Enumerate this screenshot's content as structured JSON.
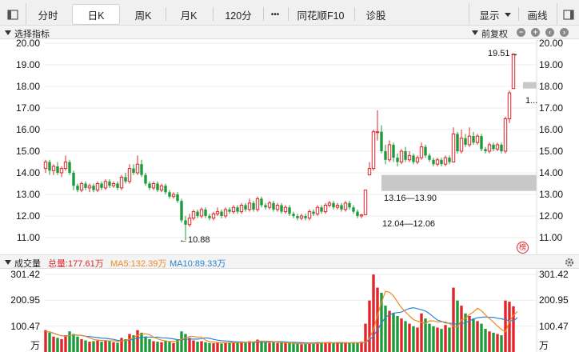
{
  "toolbar": {
    "tabs": [
      "分时",
      "日K",
      "周K",
      "月K",
      "120分",
      "•••",
      "同花顺F10",
      "诊股"
    ],
    "active": "日K",
    "display_label": "显示",
    "draw_label": "画线"
  },
  "indicator_header": {
    "label": "选择指标",
    "adjust_label": "前复权"
  },
  "price_axis": {
    "ticks": [
      "20.00",
      "19.00",
      "18.00",
      "17.00",
      "16.00",
      "15.00",
      "14.00",
      "13.00",
      "12.00",
      "11.00"
    ]
  },
  "annotations": {
    "high": "19.51→",
    "low": "←10.88",
    "gap_upper": "13.16—13.90",
    "gap_lower": "12.04—12.06",
    "cut_label": "1..."
  },
  "badge": "榜",
  "volume_header": {
    "label": "成交量",
    "total": "总量:177.61万",
    "ma5": "MA5:132.39万",
    "ma10": "MA10:89.33万"
  },
  "volume_axis": {
    "ticks": [
      "301.42",
      "200.95",
      "100.47"
    ],
    "unit": "万"
  },
  "colors": {
    "up": "#e0252b",
    "down": "#1c9b3a",
    "ma5": "#f08a1e",
    "ma10": "#2a84d6",
    "gap": "#c8c8c8"
  },
  "chart_data": {
    "type": "candlestick",
    "price_ylim": [
      10.5,
      20.5
    ],
    "volume_ylim": [
      0,
      301.42
    ],
    "candles": [
      {
        "o": 14.2,
        "c": 14.5,
        "h": 14.6,
        "l": 14.0,
        "v": 85
      },
      {
        "o": 14.5,
        "c": 14.1,
        "h": 14.6,
        "l": 13.9,
        "v": 75
      },
      {
        "o": 14.1,
        "c": 14.3,
        "h": 14.4,
        "l": 13.9,
        "v": 60
      },
      {
        "o": 14.3,
        "c": 14.0,
        "h": 14.5,
        "l": 13.9,
        "v": 55
      },
      {
        "o": 14.0,
        "c": 14.2,
        "h": 14.3,
        "l": 13.8,
        "v": 50
      },
      {
        "o": 14.2,
        "c": 14.5,
        "h": 14.8,
        "l": 14.1,
        "v": 65
      },
      {
        "o": 14.5,
        "c": 14.0,
        "h": 14.6,
        "l": 13.9,
        "v": 80
      },
      {
        "o": 14.0,
        "c": 13.4,
        "h": 14.1,
        "l": 13.2,
        "v": 70
      },
      {
        "o": 13.4,
        "c": 13.2,
        "h": 13.5,
        "l": 13.1,
        "v": 60
      },
      {
        "o": 13.2,
        "c": 13.5,
        "h": 13.6,
        "l": 13.1,
        "v": 50
      },
      {
        "o": 13.5,
        "c": 13.3,
        "h": 13.6,
        "l": 13.2,
        "v": 45
      },
      {
        "o": 13.3,
        "c": 13.4,
        "h": 13.5,
        "l": 13.1,
        "v": 40
      },
      {
        "o": 13.4,
        "c": 13.2,
        "h": 13.5,
        "l": 13.1,
        "v": 42
      },
      {
        "o": 13.2,
        "c": 13.5,
        "h": 13.6,
        "l": 13.1,
        "v": 48
      },
      {
        "o": 13.5,
        "c": 13.3,
        "h": 13.6,
        "l": 13.2,
        "v": 40
      },
      {
        "o": 13.3,
        "c": 13.6,
        "h": 13.7,
        "l": 13.2,
        "v": 46
      },
      {
        "o": 13.6,
        "c": 13.4,
        "h": 13.7,
        "l": 13.3,
        "v": 44
      },
      {
        "o": 13.4,
        "c": 13.5,
        "h": 13.6,
        "l": 13.3,
        "v": 38
      },
      {
        "o": 13.5,
        "c": 13.3,
        "h": 13.6,
        "l": 13.2,
        "v": 36
      },
      {
        "o": 13.3,
        "c": 13.8,
        "h": 13.9,
        "l": 13.2,
        "v": 55
      },
      {
        "o": 13.8,
        "c": 13.6,
        "h": 14.0,
        "l": 13.5,
        "v": 50
      },
      {
        "o": 13.6,
        "c": 14.2,
        "h": 14.4,
        "l": 13.5,
        "v": 70
      },
      {
        "o": 14.2,
        "c": 14.0,
        "h": 14.4,
        "l": 13.9,
        "v": 65
      },
      {
        "o": 14.0,
        "c": 14.4,
        "h": 14.8,
        "l": 13.9,
        "v": 85
      },
      {
        "o": 14.4,
        "c": 13.9,
        "h": 14.6,
        "l": 13.8,
        "v": 75
      },
      {
        "o": 13.9,
        "c": 13.5,
        "h": 14.0,
        "l": 13.4,
        "v": 60
      },
      {
        "o": 13.5,
        "c": 13.3,
        "h": 13.6,
        "l": 13.2,
        "v": 50
      },
      {
        "o": 13.3,
        "c": 13.5,
        "h": 13.6,
        "l": 13.2,
        "v": 42
      },
      {
        "o": 13.5,
        "c": 13.2,
        "h": 13.6,
        "l": 13.1,
        "v": 40
      },
      {
        "o": 13.2,
        "c": 13.4,
        "h": 13.5,
        "l": 13.1,
        "v": 38
      },
      {
        "o": 13.4,
        "c": 13.1,
        "h": 13.5,
        "l": 13.0,
        "v": 45
      },
      {
        "o": 13.1,
        "c": 12.9,
        "h": 13.2,
        "l": 12.8,
        "v": 40
      },
      {
        "o": 12.9,
        "c": 13.0,
        "h": 13.1,
        "l": 12.8,
        "v": 35
      },
      {
        "o": 13.0,
        "c": 12.7,
        "h": 13.1,
        "l": 12.6,
        "v": 48
      },
      {
        "o": 12.7,
        "c": 11.8,
        "h": 12.8,
        "l": 11.7,
        "v": 80
      },
      {
        "o": 11.8,
        "c": 11.6,
        "h": 12.0,
        "l": 10.88,
        "v": 70
      },
      {
        "o": 11.6,
        "c": 11.9,
        "h": 12.1,
        "l": 11.5,
        "v": 55
      },
      {
        "o": 11.9,
        "c": 12.2,
        "h": 12.3,
        "l": 11.8,
        "v": 45
      },
      {
        "o": 12.2,
        "c": 12.0,
        "h": 12.3,
        "l": 11.9,
        "v": 40
      },
      {
        "o": 12.0,
        "c": 12.3,
        "h": 12.4,
        "l": 11.9,
        "v": 42
      },
      {
        "o": 12.3,
        "c": 12.0,
        "h": 12.4,
        "l": 11.9,
        "v": 38
      },
      {
        "o": 12.0,
        "c": 11.9,
        "h": 12.1,
        "l": 11.8,
        "v": 35
      },
      {
        "o": 11.9,
        "c": 12.1,
        "h": 12.2,
        "l": 11.8,
        "v": 34
      },
      {
        "o": 12.1,
        "c": 12.2,
        "h": 12.4,
        "l": 12.0,
        "v": 36
      },
      {
        "o": 12.2,
        "c": 12.0,
        "h": 12.3,
        "l": 11.9,
        "v": 33
      },
      {
        "o": 12.0,
        "c": 12.3,
        "h": 12.4,
        "l": 11.9,
        "v": 37
      },
      {
        "o": 12.3,
        "c": 12.2,
        "h": 12.4,
        "l": 12.1,
        "v": 35
      },
      {
        "o": 12.2,
        "c": 12.4,
        "h": 12.5,
        "l": 12.1,
        "v": 38
      },
      {
        "o": 12.4,
        "c": 12.2,
        "h": 12.5,
        "l": 12.1,
        "v": 36
      },
      {
        "o": 12.2,
        "c": 12.5,
        "h": 12.6,
        "l": 12.1,
        "v": 40
      },
      {
        "o": 12.5,
        "c": 12.3,
        "h": 12.6,
        "l": 12.2,
        "v": 38
      },
      {
        "o": 12.3,
        "c": 12.6,
        "h": 12.8,
        "l": 12.2,
        "v": 42
      },
      {
        "o": 12.6,
        "c": 12.3,
        "h": 12.7,
        "l": 12.2,
        "v": 40
      },
      {
        "o": 12.3,
        "c": 12.8,
        "h": 12.9,
        "l": 12.2,
        "v": 48
      },
      {
        "o": 12.8,
        "c": 12.5,
        "h": 12.9,
        "l": 12.4,
        "v": 44
      },
      {
        "o": 12.5,
        "c": 12.4,
        "h": 12.6,
        "l": 12.3,
        "v": 38
      },
      {
        "o": 12.4,
        "c": 12.6,
        "h": 12.7,
        "l": 12.3,
        "v": 36
      },
      {
        "o": 12.6,
        "c": 12.3,
        "h": 12.7,
        "l": 12.2,
        "v": 40
      },
      {
        "o": 12.3,
        "c": 12.5,
        "h": 12.6,
        "l": 12.2,
        "v": 35
      },
      {
        "o": 12.5,
        "c": 12.2,
        "h": 12.6,
        "l": 12.1,
        "v": 38
      },
      {
        "o": 12.2,
        "c": 12.4,
        "h": 12.5,
        "l": 12.1,
        "v": 34
      },
      {
        "o": 12.4,
        "c": 12.1,
        "h": 12.5,
        "l": 12.0,
        "v": 36
      },
      {
        "o": 12.1,
        "c": 12.0,
        "h": 12.2,
        "l": 11.9,
        "v": 33
      },
      {
        "o": 12.0,
        "c": 11.9,
        "h": 12.1,
        "l": 11.8,
        "v": 32
      },
      {
        "o": 11.9,
        "c": 12.0,
        "h": 12.1,
        "l": 11.8,
        "v": 30
      },
      {
        "o": 12.0,
        "c": 11.9,
        "h": 12.1,
        "l": 11.8,
        "v": 31
      },
      {
        "o": 11.9,
        "c": 12.2,
        "h": 12.3,
        "l": 11.8,
        "v": 36
      },
      {
        "o": 12.2,
        "c": 12.1,
        "h": 12.3,
        "l": 12.0,
        "v": 33
      },
      {
        "o": 12.1,
        "c": 12.4,
        "h": 12.5,
        "l": 12.0,
        "v": 38
      },
      {
        "o": 12.4,
        "c": 12.2,
        "h": 12.5,
        "l": 12.1,
        "v": 35
      },
      {
        "o": 12.2,
        "c": 12.5,
        "h": 12.6,
        "l": 12.1,
        "v": 37
      },
      {
        "o": 12.5,
        "c": 12.6,
        "h": 12.7,
        "l": 12.4,
        "v": 39
      },
      {
        "o": 12.6,
        "c": 12.4,
        "h": 12.7,
        "l": 12.3,
        "v": 36
      },
      {
        "o": 12.4,
        "c": 12.5,
        "h": 12.6,
        "l": 12.3,
        "v": 34
      },
      {
        "o": 12.5,
        "c": 12.3,
        "h": 12.6,
        "l": 12.2,
        "v": 35
      },
      {
        "o": 12.3,
        "c": 12.6,
        "h": 12.7,
        "l": 12.2,
        "v": 38
      },
      {
        "o": 12.6,
        "c": 12.4,
        "h": 12.7,
        "l": 12.3,
        "v": 36
      },
      {
        "o": 12.4,
        "c": 12.2,
        "h": 12.5,
        "l": 12.1,
        "v": 34
      },
      {
        "o": 12.2,
        "c": 12.0,
        "h": 12.3,
        "l": 11.9,
        "v": 35
      },
      {
        "o": 12.0,
        "c": 12.05,
        "h": 12.1,
        "l": 11.9,
        "v": 40
      },
      {
        "o": 12.06,
        "c": 13.2,
        "h": 13.2,
        "l": 12.06,
        "v": 110
      },
      {
        "o": 13.9,
        "c": 14.2,
        "h": 14.5,
        "l": 13.9,
        "v": 200
      },
      {
        "o": 14.2,
        "c": 15.9,
        "h": 16.0,
        "l": 14.1,
        "v": 301
      },
      {
        "o": 15.9,
        "c": 15.9,
        "h": 16.9,
        "l": 15.5,
        "v": 250
      },
      {
        "o": 15.9,
        "c": 15.0,
        "h": 16.2,
        "l": 14.9,
        "v": 230
      },
      {
        "o": 15.0,
        "c": 14.6,
        "h": 15.3,
        "l": 14.4,
        "v": 180
      },
      {
        "o": 14.6,
        "c": 15.3,
        "h": 15.5,
        "l": 14.5,
        "v": 160
      },
      {
        "o": 15.3,
        "c": 14.7,
        "h": 15.4,
        "l": 14.5,
        "v": 150
      },
      {
        "o": 14.7,
        "c": 14.5,
        "h": 14.9,
        "l": 14.3,
        "v": 140
      },
      {
        "o": 14.5,
        "c": 15.0,
        "h": 15.1,
        "l": 14.4,
        "v": 130
      },
      {
        "o": 15.0,
        "c": 14.6,
        "h": 15.2,
        "l": 14.5,
        "v": 120
      },
      {
        "o": 14.6,
        "c": 14.8,
        "h": 15.0,
        "l": 14.5,
        "v": 110
      },
      {
        "o": 14.8,
        "c": 14.5,
        "h": 14.9,
        "l": 14.4,
        "v": 100
      },
      {
        "o": 14.5,
        "c": 14.7,
        "h": 14.8,
        "l": 14.4,
        "v": 95
      },
      {
        "o": 14.7,
        "c": 15.2,
        "h": 15.4,
        "l": 14.6,
        "v": 150
      },
      {
        "o": 15.2,
        "c": 14.8,
        "h": 15.3,
        "l": 14.7,
        "v": 130
      },
      {
        "o": 14.8,
        "c": 14.6,
        "h": 14.9,
        "l": 14.5,
        "v": 110
      },
      {
        "o": 14.6,
        "c": 14.4,
        "h": 14.7,
        "l": 14.3,
        "v": 100
      },
      {
        "o": 14.4,
        "c": 14.6,
        "h": 14.7,
        "l": 14.3,
        "v": 95
      },
      {
        "o": 14.6,
        "c": 14.4,
        "h": 14.7,
        "l": 14.3,
        "v": 90
      },
      {
        "o": 14.4,
        "c": 14.7,
        "h": 14.8,
        "l": 14.3,
        "v": 105
      },
      {
        "o": 14.7,
        "c": 14.5,
        "h": 14.8,
        "l": 14.4,
        "v": 95
      },
      {
        "o": 14.5,
        "c": 15.8,
        "h": 16.1,
        "l": 14.5,
        "v": 250
      },
      {
        "o": 15.8,
        "c": 15.0,
        "h": 15.9,
        "l": 14.9,
        "v": 200
      },
      {
        "o": 15.0,
        "c": 15.6,
        "h": 16.0,
        "l": 14.9,
        "v": 180
      },
      {
        "o": 15.6,
        "c": 15.3,
        "h": 15.8,
        "l": 15.2,
        "v": 150
      },
      {
        "o": 15.3,
        "c": 15.7,
        "h": 16.1,
        "l": 15.2,
        "v": 140
      },
      {
        "o": 15.7,
        "c": 15.4,
        "h": 15.9,
        "l": 15.3,
        "v": 130
      },
      {
        "o": 15.4,
        "c": 15.7,
        "h": 15.8,
        "l": 15.3,
        "v": 120
      },
      {
        "o": 15.7,
        "c": 15.1,
        "h": 15.8,
        "l": 15.0,
        "v": 110
      },
      {
        "o": 15.1,
        "c": 15.0,
        "h": 15.2,
        "l": 14.9,
        "v": 90
      },
      {
        "o": 15.0,
        "c": 15.3,
        "h": 15.4,
        "l": 14.9,
        "v": 80
      },
      {
        "o": 15.3,
        "c": 15.1,
        "h": 15.4,
        "l": 15.0,
        "v": 75
      },
      {
        "o": 15.1,
        "c": 15.3,
        "h": 15.4,
        "l": 15.0,
        "v": 70
      },
      {
        "o": 15.3,
        "c": 15.0,
        "h": 15.4,
        "l": 14.9,
        "v": 65
      },
      {
        "o": 15.0,
        "c": 16.5,
        "h": 16.6,
        "l": 14.9,
        "v": 200
      },
      {
        "o": 16.5,
        "c": 17.7,
        "h": 17.8,
        "l": 16.3,
        "v": 195
      },
      {
        "o": 17.9,
        "c": 19.5,
        "h": 19.51,
        "l": 17.9,
        "v": 177.61
      }
    ],
    "ma5": [
      80,
      78,
      73,
      67,
      63,
      61,
      64,
      66,
      65,
      65,
      61,
      55,
      49,
      45,
      45,
      44,
      43,
      44,
      41,
      43,
      44,
      50,
      54,
      65,
      69,
      71,
      67,
      58,
      51,
      46,
      43,
      41,
      42,
      41,
      50,
      55,
      60,
      60,
      58,
      58,
      46,
      40,
      39,
      37,
      37,
      36,
      36,
      36,
      37,
      37,
      37,
      39,
      39,
      42,
      42,
      42,
      42,
      40,
      38,
      37,
      36,
      36,
      34,
      33,
      32,
      32,
      33,
      33,
      34,
      35,
      36,
      36,
      36,
      37,
      37,
      36,
      36,
      36,
      36,
      36,
      38,
      53,
      87,
      142,
      192,
      236,
      232,
      218,
      194,
      172,
      156,
      140,
      126,
      120,
      115,
      111,
      121,
      121,
      117,
      117,
      117,
      110,
      100,
      97,
      125,
      130,
      146,
      155,
      170,
      160,
      144,
      130,
      116,
      101,
      88,
      78,
      118,
      143,
      157
    ],
    "ma10": [
      80,
      78,
      73,
      67,
      63,
      62,
      64,
      66,
      66,
      64,
      61,
      60,
      58,
      56,
      54,
      53,
      51,
      49,
      45,
      44,
      44,
      47,
      49,
      54,
      57,
      58,
      58,
      57,
      58,
      55,
      55,
      53,
      51,
      48,
      48,
      49,
      50,
      50,
      50,
      52,
      55,
      53,
      49,
      46,
      44,
      43,
      42,
      40,
      39,
      39,
      38,
      38,
      38,
      38,
      38,
      38,
      39,
      39,
      40,
      40,
      39,
      38,
      38,
      37,
      36,
      35,
      35,
      35,
      36,
      36,
      36,
      36,
      35,
      35,
      35,
      35,
      35,
      36,
      36,
      36,
      37,
      47,
      62,
      86,
      112,
      135,
      145,
      151,
      153,
      155,
      163,
      169,
      172,
      168,
      164,
      159,
      149,
      136,
      124,
      119,
      113,
      112,
      111,
      107,
      111,
      113,
      121,
      128,
      133,
      135,
      136,
      135,
      135,
      131,
      129,
      125,
      122,
      121,
      134
    ]
  }
}
